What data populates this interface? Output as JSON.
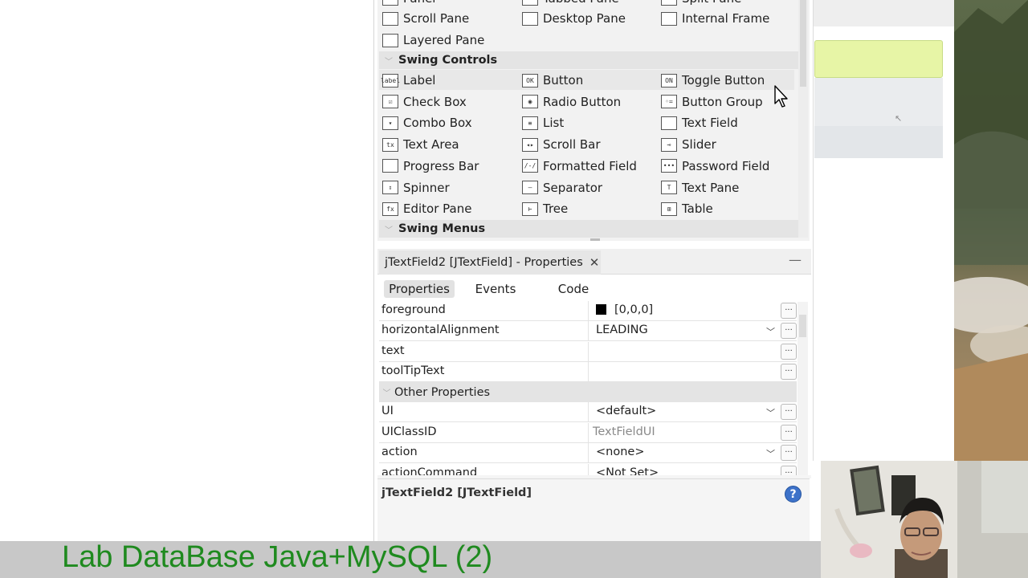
{
  "palette": {
    "top_partial_items": [
      {
        "label": "Panel",
        "icon": "panel-icon"
      },
      {
        "label": "Tabbed Pane",
        "icon": "tabbed-pane-icon"
      },
      {
        "label": "Split Pane",
        "icon": "split-pane-icon"
      }
    ],
    "containers_rows": [
      [
        {
          "label": "Scroll Pane",
          "icon": "scroll-pane-icon"
        },
        {
          "label": "Desktop Pane",
          "icon": "desktop-pane-icon"
        },
        {
          "label": "Internal Frame",
          "icon": "internal-frame-icon"
        }
      ],
      [
        {
          "label": "Layered Pane",
          "icon": "layered-pane-icon"
        }
      ]
    ],
    "swing_controls_header": "Swing Controls",
    "swing_controls_rows": [
      [
        {
          "label": "Label",
          "icon": "label-icon",
          "glyph": "label"
        },
        {
          "label": "Button",
          "icon": "button-icon",
          "glyph": "OK"
        },
        {
          "label": "Toggle Button",
          "icon": "toggle-button-icon",
          "glyph": "ON"
        }
      ],
      [
        {
          "label": "Check Box",
          "icon": "check-box-icon",
          "glyph": "☑"
        },
        {
          "label": "Radio Button",
          "icon": "radio-button-icon",
          "glyph": "◉"
        },
        {
          "label": "Button Group",
          "icon": "button-group-icon",
          "glyph": "◦="
        }
      ],
      [
        {
          "label": "Combo Box",
          "icon": "combo-box-icon",
          "glyph": "▾"
        },
        {
          "label": "List",
          "icon": "list-icon",
          "glyph": "≡"
        },
        {
          "label": "Text Field",
          "icon": "text-field-icon",
          "glyph": ""
        }
      ],
      [
        {
          "label": "Text Area",
          "icon": "text-area-icon",
          "glyph": "tx"
        },
        {
          "label": "Scroll Bar",
          "icon": "scroll-bar-icon",
          "glyph": "◂▸"
        },
        {
          "label": "Slider",
          "icon": "slider-icon",
          "glyph": "⊸"
        }
      ],
      [
        {
          "label": "Progress Bar",
          "icon": "progress-bar-icon",
          "glyph": ""
        },
        {
          "label": "Formatted Field",
          "icon": "formatted-field-icon",
          "glyph": "/-/"
        },
        {
          "label": "Password Field",
          "icon": "password-field-icon",
          "glyph": "•••"
        }
      ],
      [
        {
          "label": "Spinner",
          "icon": "spinner-icon",
          "glyph": "⇕"
        },
        {
          "label": "Separator",
          "icon": "separator-icon",
          "glyph": "—"
        },
        {
          "label": "Text Pane",
          "icon": "text-pane-icon",
          "glyph": "T"
        }
      ],
      [
        {
          "label": "Editor Pane",
          "icon": "editor-pane-icon",
          "glyph": "fx"
        },
        {
          "label": "Tree",
          "icon": "tree-icon",
          "glyph": "⊢"
        },
        {
          "label": "Table",
          "icon": "table-icon",
          "glyph": "⊞"
        }
      ]
    ],
    "swing_menus_header": "Swing Menus"
  },
  "properties_window": {
    "tab_title": "jTextField2 [JTextField] - Properties",
    "close_glyph": "✕",
    "minimize_glyph": "—",
    "subtabs": [
      "Properties",
      "Events",
      "Code"
    ],
    "active_subtab": "Properties",
    "rows_top": [
      {
        "name": "foreground",
        "value": "[0,0,0]",
        "swatch_color": "#000000",
        "dropdown": false
      },
      {
        "name": "horizontalAlignment",
        "value": "LEADING",
        "dropdown": true
      },
      {
        "name": "text",
        "value": "",
        "dropdown": false
      },
      {
        "name": "toolTipText",
        "value": "",
        "dropdown": false
      }
    ],
    "other_header": "Other Properties",
    "rows_other": [
      {
        "name": "UI",
        "value": "<default>",
        "dropdown": true,
        "muted": false
      },
      {
        "name": "UIClassID",
        "value": "TextFieldUI",
        "dropdown": false,
        "muted": true
      },
      {
        "name": "action",
        "value": "<none>",
        "dropdown": true,
        "muted": false
      },
      {
        "name": "actionCommand",
        "value": "<Not Set>",
        "dropdown": false,
        "muted": false
      }
    ],
    "dots_glyph": "...",
    "description_title": "jTextField2 [JTextField]",
    "help_glyph": "?"
  },
  "caption": {
    "text": "Lab DataBase Java+MySQL (2)",
    "color": "#1f8a1f"
  },
  "design_area": {
    "selected_field_color": "#e7f5a6"
  }
}
